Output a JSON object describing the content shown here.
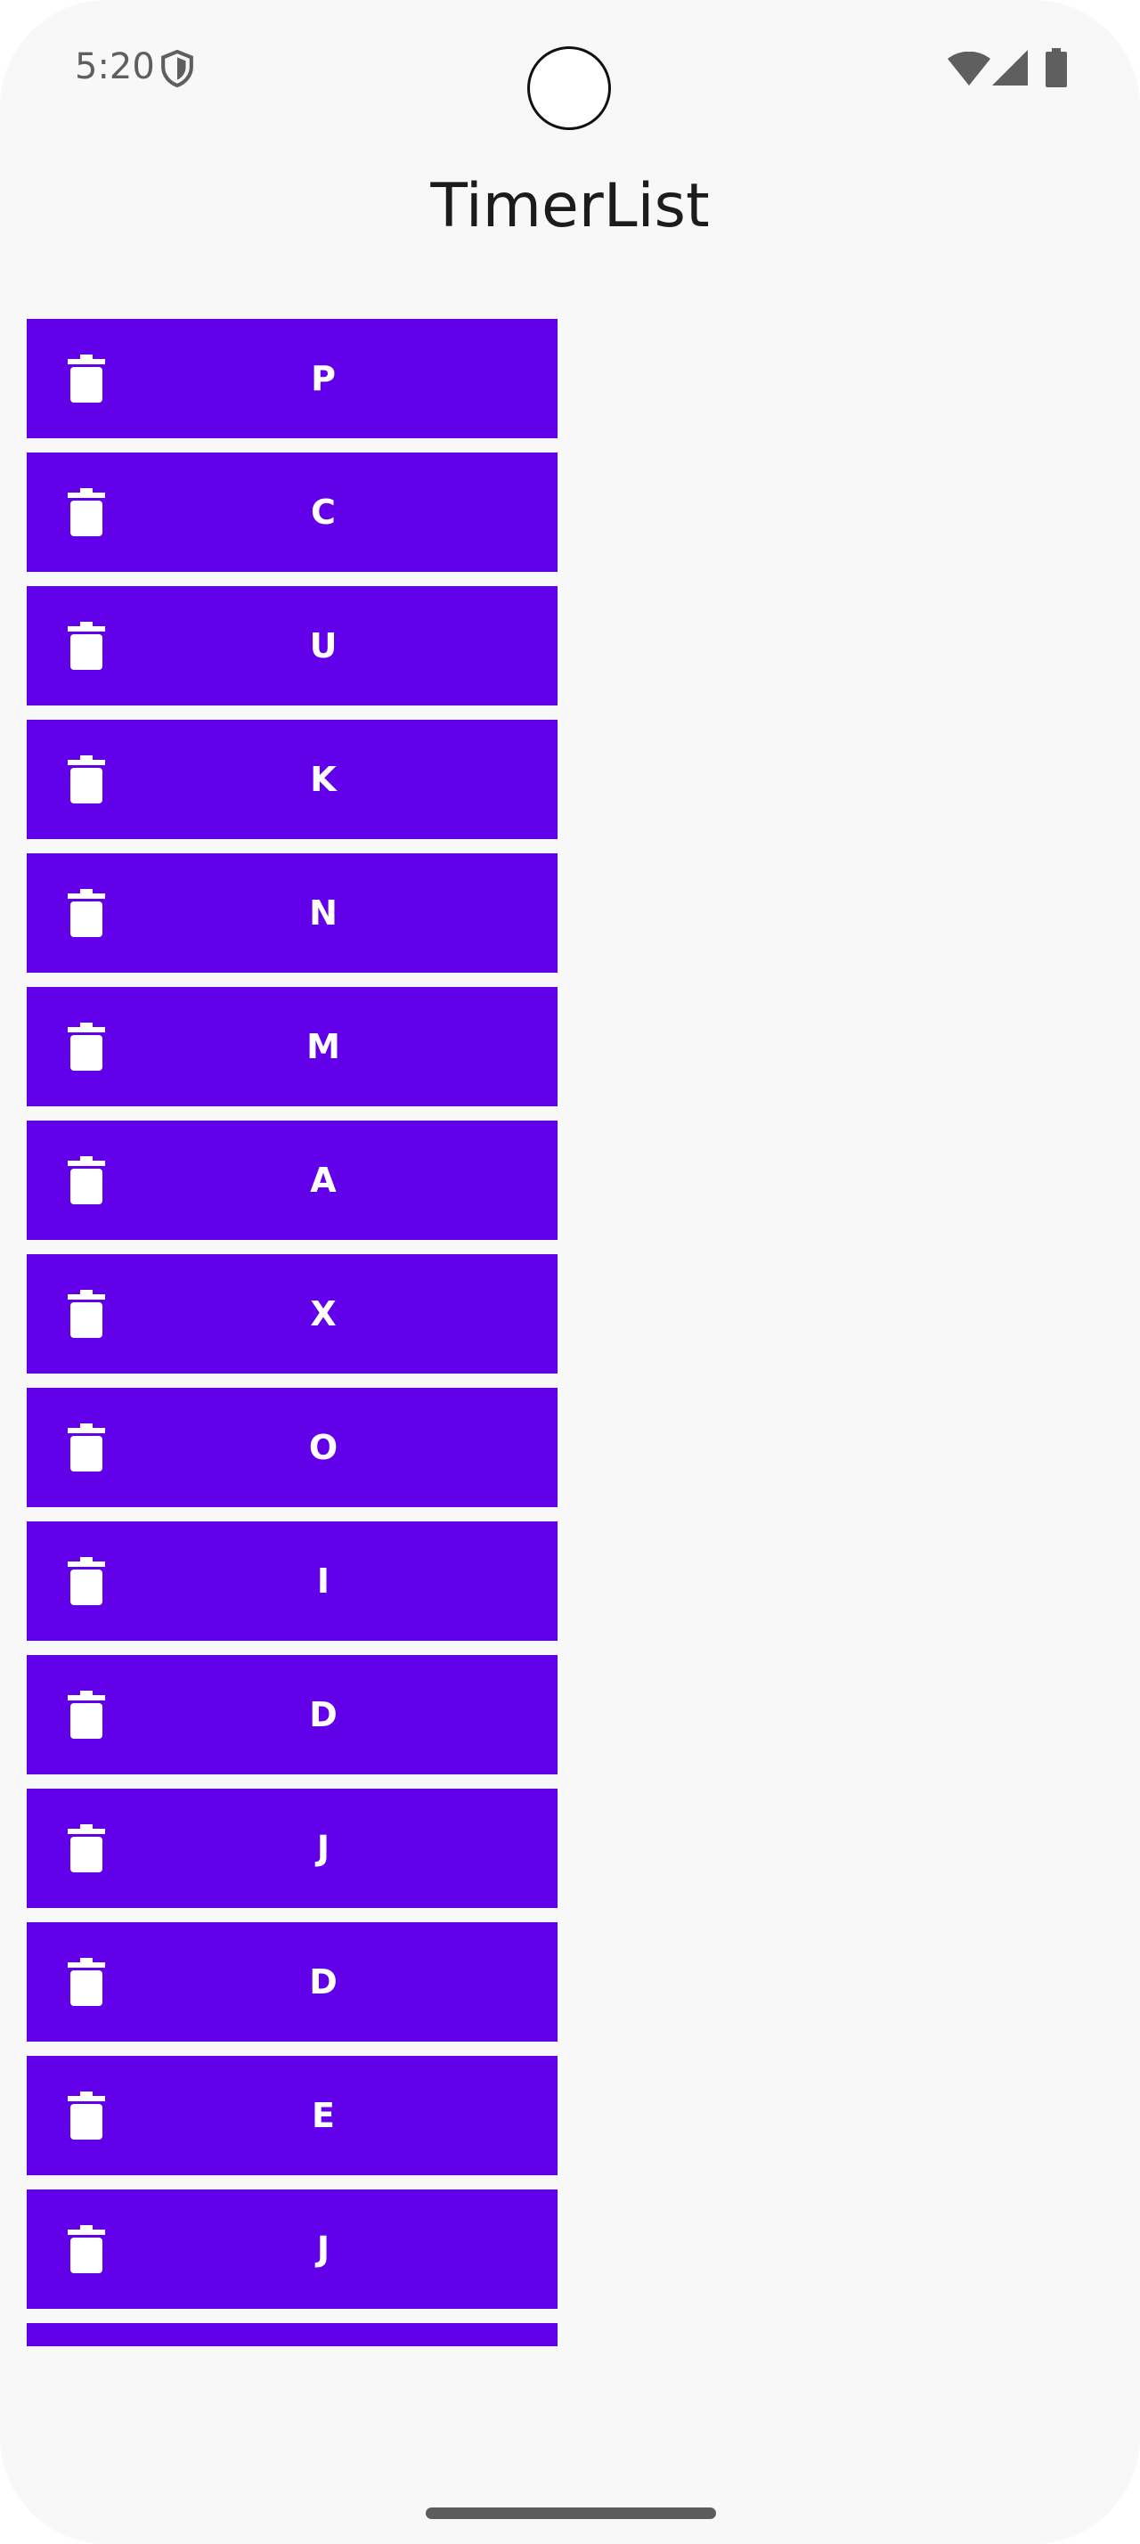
{
  "status_bar": {
    "time": "5:20",
    "icons": [
      "shield-icon",
      "wifi-icon",
      "cellular-signal-icon",
      "battery-icon"
    ],
    "icon_color": "#5f5f5f"
  },
  "app": {
    "title": "TimerList"
  },
  "colors": {
    "item_background": "#6200ea",
    "item_text": "#ffffff",
    "screen_background": "#f8f8f8"
  },
  "timers": [
    {
      "label": "P"
    },
    {
      "label": "C"
    },
    {
      "label": "U"
    },
    {
      "label": "K"
    },
    {
      "label": "N"
    },
    {
      "label": "M"
    },
    {
      "label": "A"
    },
    {
      "label": "X"
    },
    {
      "label": "O"
    },
    {
      "label": "I"
    },
    {
      "label": "D"
    },
    {
      "label": "J"
    },
    {
      "label": "D"
    },
    {
      "label": "E"
    },
    {
      "label": "J"
    },
    {
      "label": ""
    }
  ],
  "item_icon": "trash-icon"
}
